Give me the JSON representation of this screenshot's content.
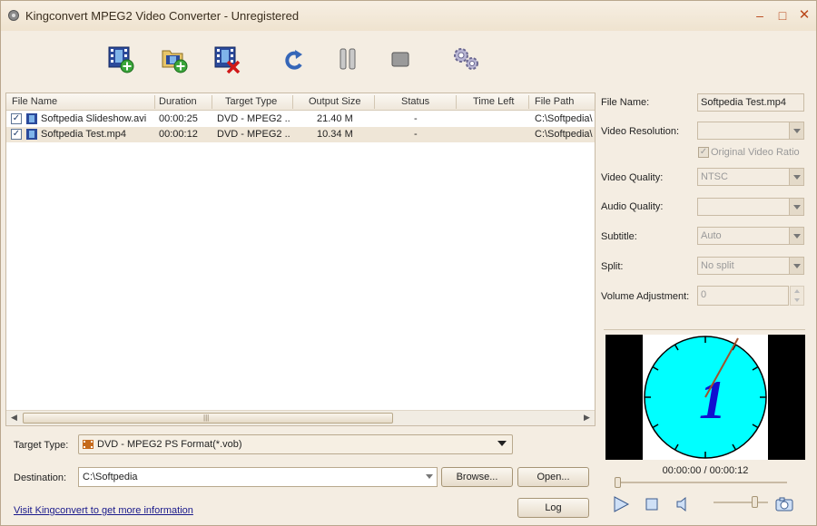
{
  "window": {
    "title": "Kingconvert MPEG2 Video Converter - Unregistered",
    "controls": {
      "minimize": "–",
      "maximize": "□",
      "close": "✕"
    }
  },
  "toolbar": {
    "buttons": [
      {
        "name": "add-video-button",
        "icon": "add-video-icon"
      },
      {
        "name": "add-folder-button",
        "icon": "add-folder-icon"
      },
      {
        "name": "remove-button",
        "icon": "remove-video-icon"
      },
      {
        "name": "convert-button",
        "icon": "refresh-icon"
      },
      {
        "name": "pause-button",
        "icon": "pause-icon"
      },
      {
        "name": "stop-button",
        "icon": "stop-icon"
      },
      {
        "name": "settings-button",
        "icon": "gear-icon"
      }
    ]
  },
  "file_list": {
    "columns": [
      "File Name",
      "Duration",
      "Target Type",
      "Output Size",
      "Status",
      "Time Left",
      "File Path"
    ],
    "rows": [
      {
        "checked": true,
        "name": "Softpedia Slideshow.avi",
        "duration": "00:00:25",
        "target": "DVD - MPEG2 ...",
        "size": "21.40 M",
        "status": "-",
        "time_left": "",
        "path": "C:\\Softpedia\\"
      },
      {
        "checked": true,
        "name": "Softpedia Test.mp4",
        "duration": "00:00:12",
        "target": "DVD - MPEG2 ...",
        "size": "10.34 M",
        "status": "-",
        "time_left": "",
        "path": "C:\\Softpedia\\"
      }
    ],
    "scroll_grip": "|||"
  },
  "target_type": {
    "label": "Target Type:",
    "value": "DVD - MPEG2 PS Format(*.vob)"
  },
  "destination": {
    "label": "Destination:",
    "value": "C:\\Softpedia",
    "browse": "Browse...",
    "open": "Open..."
  },
  "footer": {
    "link": "Visit Kingconvert to get more information",
    "log": "Log"
  },
  "properties": {
    "file_name": {
      "label": "File Name:",
      "value": "Softpedia Test.mp4"
    },
    "video_resolution": {
      "label": "Video Resolution:",
      "value": ""
    },
    "original_ratio": {
      "label": "Original Video Ratio",
      "checked": true
    },
    "video_quality": {
      "label": "Video Quality:",
      "value": "NTSC"
    },
    "audio_quality": {
      "label": "Audio Quality:",
      "value": ""
    },
    "subtitle": {
      "label": "Subtitle:",
      "value": "Auto"
    },
    "split": {
      "label": "Split:",
      "value": "No split"
    },
    "volume": {
      "label": "Volume Adjustment:",
      "value": "0"
    }
  },
  "player": {
    "clock_numeral": "1",
    "timecode": "00:00:00 / 00:00:12",
    "seek_fraction": 0.0,
    "volume_fraction": 0.8,
    "colors": {
      "clock_face": "#00ffff",
      "numeral": "#1010d0",
      "hand": "#a0522d"
    }
  }
}
